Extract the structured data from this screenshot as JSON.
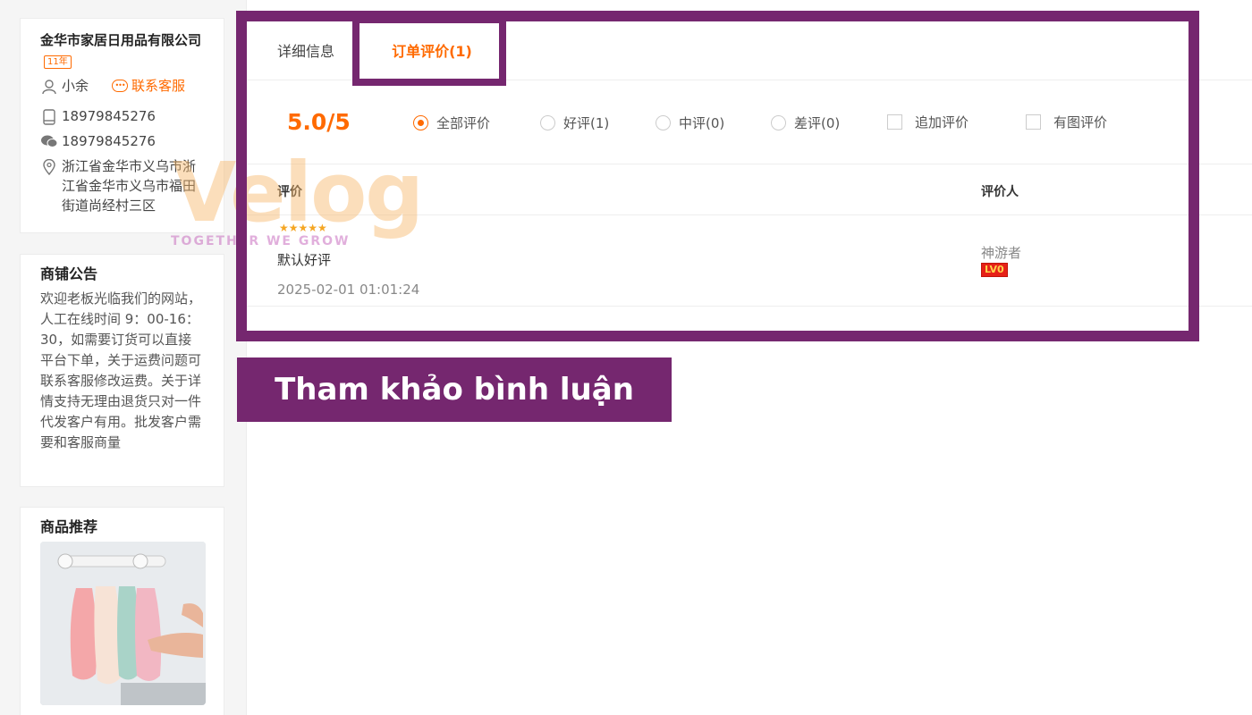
{
  "shop": {
    "name": "金华市家居日用品有限公司",
    "years_badge": "11年",
    "owner": "小余",
    "contact_label": "联系客服",
    "phone": "18979845276",
    "wechat": "18979845276",
    "address": "浙江省金华市义乌市浙江省金华市义乌市福田街道尚经村三区"
  },
  "notice": {
    "title": "商铺公告",
    "text": "欢迎老板光临我们的网站，人工在线时间 9：00-16：30，如需要订货可以直接平台下单，关于运费问题可联系客服修改运费。关于详情支持无理由退货只对一件代发客户有用。批发客户需要和客服商量"
  },
  "recommend": {
    "title": "商品推荐"
  },
  "tabs": {
    "detail": "详细信息",
    "reviews": "订单评价(1)"
  },
  "filters": {
    "score": "5.0/5",
    "all": "全部评价",
    "good": "好评(1)",
    "neutral": "中评(0)",
    "bad": "差评(0)",
    "followup": "追加评价",
    "with_images": "有图评价"
  },
  "table": {
    "col_review": "评价",
    "col_reviewer": "评价人"
  },
  "review": {
    "stars": "★★★★★",
    "rating": 5,
    "text": "默认好评",
    "time": "2025-02-01 01:01:24",
    "reviewer": "神游者",
    "level": "LV0"
  },
  "annotation": {
    "banner": "Tham khảo bình luận"
  },
  "watermark": {
    "logo": "Velog",
    "tagline": "TOGETHER WE GROW"
  },
  "colors": {
    "accent": "#ff6a00",
    "highlight": "#75276f"
  }
}
